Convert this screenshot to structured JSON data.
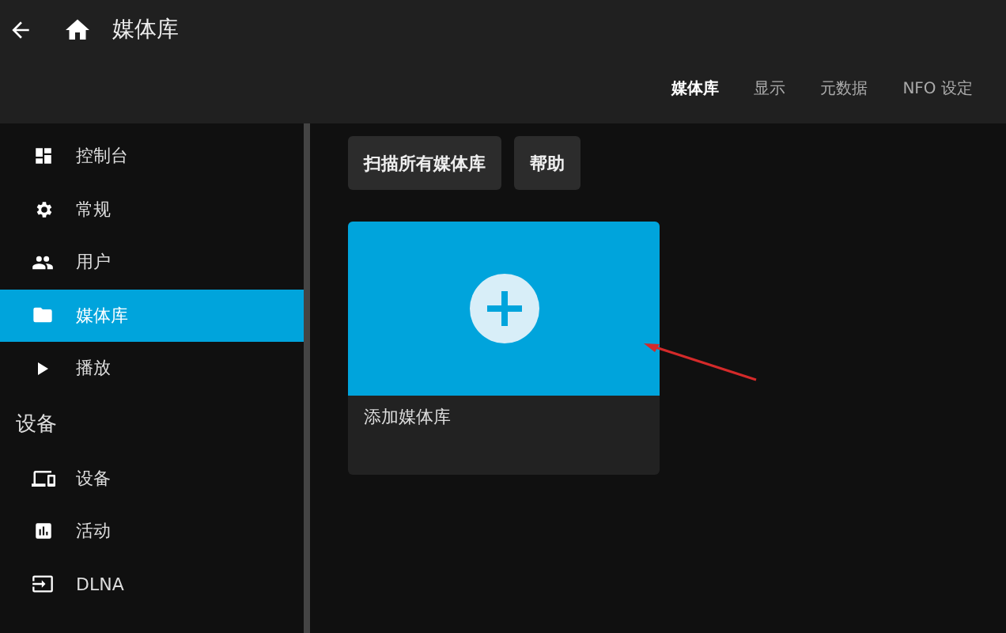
{
  "header": {
    "title": "媒体库",
    "tabs": [
      {
        "label": "媒体库",
        "selected": true
      },
      {
        "label": "显示",
        "selected": false
      },
      {
        "label": "元数据",
        "selected": false
      },
      {
        "label": "NFO 设定",
        "selected": false
      }
    ]
  },
  "sidebar": {
    "sections": [
      {
        "items": [
          {
            "label": "控制台",
            "selected": false
          },
          {
            "label": "常规",
            "selected": false
          },
          {
            "label": "用户",
            "selected": false
          },
          {
            "label": "媒体库",
            "selected": true
          },
          {
            "label": "播放",
            "selected": false
          }
        ]
      },
      {
        "header": "设备",
        "items": [
          {
            "label": "设备",
            "selected": false
          },
          {
            "label": "活动",
            "selected": false
          },
          {
            "label": "DLNA",
            "selected": false
          }
        ]
      }
    ]
  },
  "buttons": [
    "扫描所有媒体库",
    "帮助"
  ],
  "add_card": {
    "label": "添加媒体库"
  }
}
